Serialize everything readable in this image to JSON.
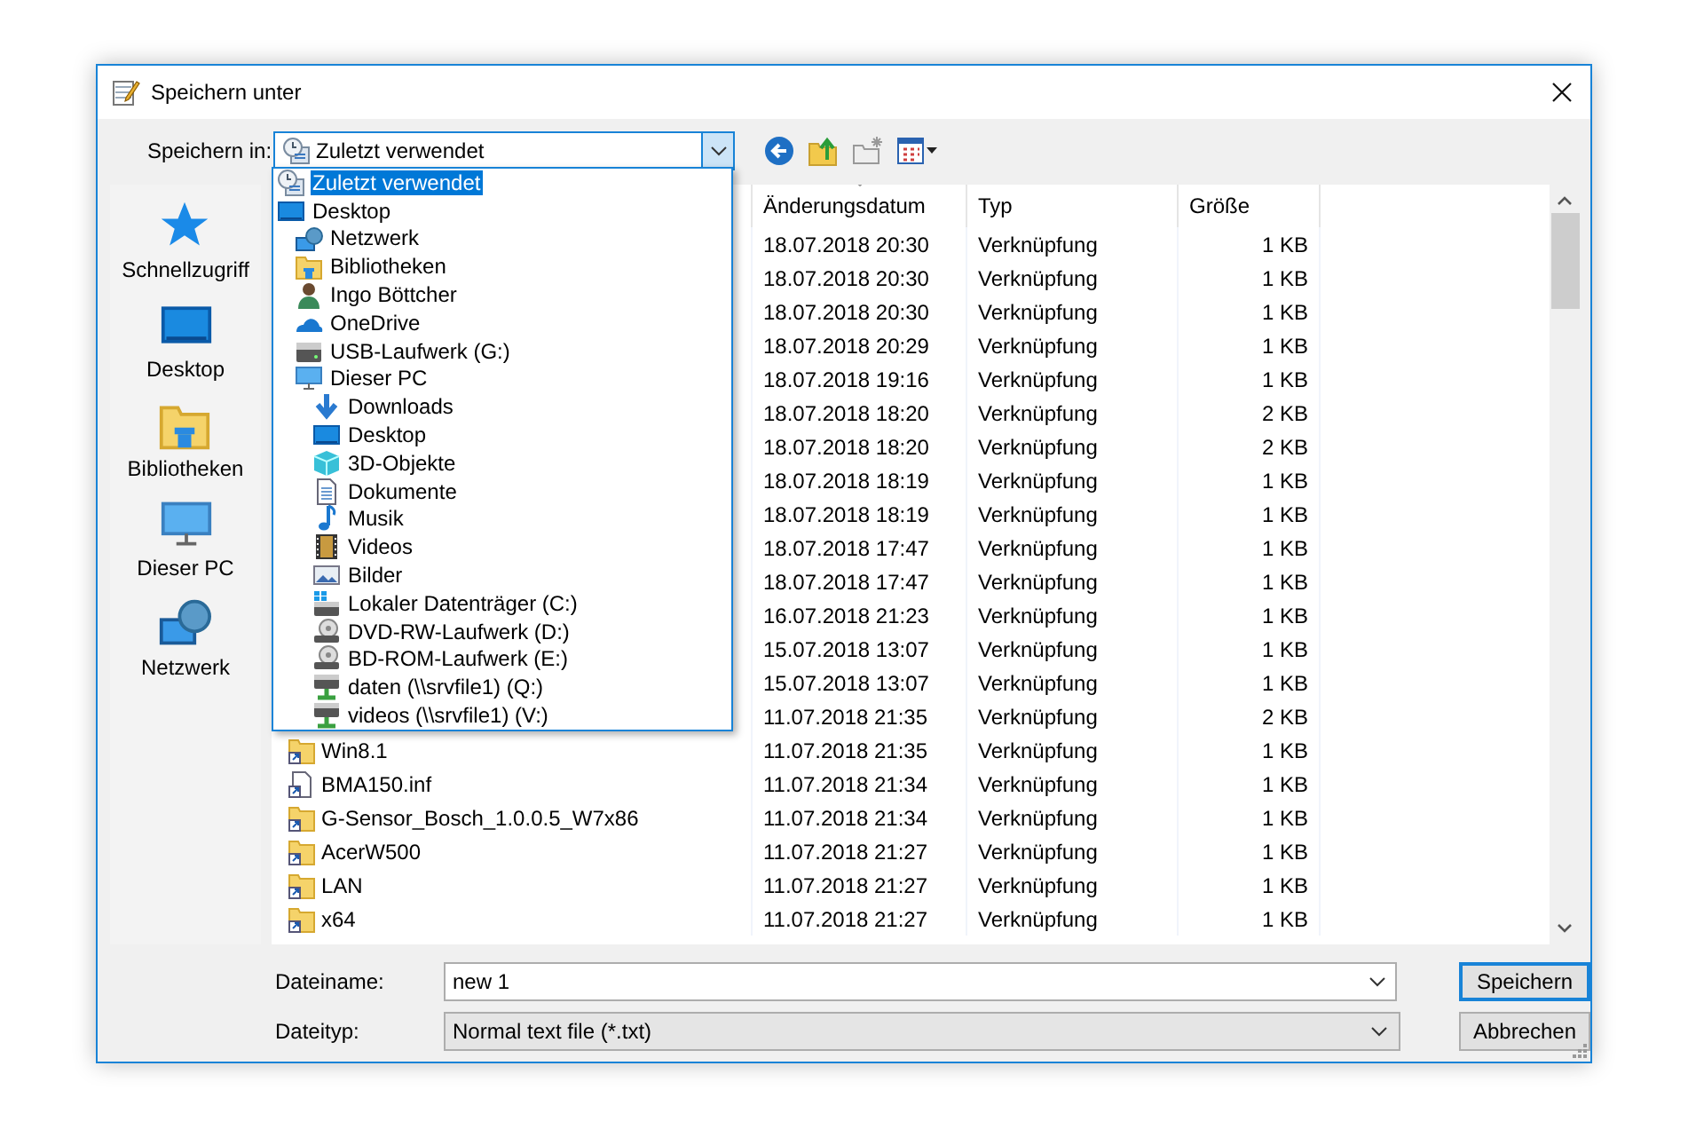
{
  "window": {
    "title": "Speichern unter"
  },
  "location": {
    "label": "Speichern in:",
    "value": "Zuletzt verwendet",
    "kind": "recent"
  },
  "location_menu": [
    {
      "label": "Zuletzt verwendet",
      "kind": "recent",
      "selected": true
    },
    {
      "label": "Desktop",
      "kind": "desktop",
      "selected": false,
      "children": [
        {
          "label": "Netzwerk",
          "kind": "network",
          "selected": false
        },
        {
          "label": "Bibliotheken",
          "kind": "library",
          "selected": false
        },
        {
          "label": "Ingo Böttcher",
          "kind": "user",
          "selected": false
        },
        {
          "label": "OneDrive",
          "kind": "cloud",
          "selected": false
        },
        {
          "label": "USB-Laufwerk (G:)",
          "kind": "drive",
          "selected": false
        },
        {
          "label": "Dieser PC",
          "kind": "pc",
          "selected": false,
          "children": [
            {
              "label": "Downloads",
              "kind": "downloads",
              "selected": false
            },
            {
              "label": "Desktop",
              "kind": "desktop",
              "selected": false
            },
            {
              "label": "3D-Objekte",
              "kind": "cube",
              "selected": false
            },
            {
              "label": "Dokumente",
              "kind": "document",
              "selected": false
            },
            {
              "label": "Musik",
              "kind": "music",
              "selected": false
            },
            {
              "label": "Videos",
              "kind": "video",
              "selected": false
            },
            {
              "label": "Bilder",
              "kind": "picture",
              "selected": false
            },
            {
              "label": "Lokaler Datenträger (C:)",
              "kind": "system-drive",
              "selected": false
            },
            {
              "label": "DVD-RW-Laufwerk (D:)",
              "kind": "optical",
              "selected": false
            },
            {
              "label": "BD-ROM-Laufwerk (E:)",
              "kind": "optical",
              "selected": false
            },
            {
              "label": "daten (\\\\srvfile1) (Q:)",
              "kind": "net-drive",
              "selected": false
            },
            {
              "label": "videos (\\\\srvfile1) (V:)",
              "kind": "net-drive",
              "selected": false
            }
          ]
        }
      ]
    }
  ],
  "sidebar": {
    "items": [
      {
        "label": "Schnellzugriff",
        "kind": "star"
      },
      {
        "label": "Desktop",
        "kind": "desktop"
      },
      {
        "label": "Bibliotheken",
        "kind": "library"
      },
      {
        "label": "Dieser PC",
        "kind": "pc"
      },
      {
        "label": "Netzwerk",
        "kind": "network"
      }
    ]
  },
  "file_list": {
    "columns": [
      {
        "label": "Änderungsdatum",
        "sorted": true
      },
      {
        "label": "Typ",
        "sorted": false
      },
      {
        "label": "Größe",
        "sorted": false
      }
    ],
    "rows": [
      {
        "date": "18.07.2018 20:30",
        "type": "Verknüpfung",
        "size": "1 KB"
      },
      {
        "date": "18.07.2018 20:30",
        "type": "Verknüpfung",
        "size": "1 KB"
      },
      {
        "date": "18.07.2018 20:30",
        "type": "Verknüpfung",
        "size": "1 KB"
      },
      {
        "date": "18.07.2018 20:29",
        "type": "Verknüpfung",
        "size": "1 KB"
      },
      {
        "date": "18.07.2018 19:16",
        "type": "Verknüpfung",
        "size": "1 KB"
      },
      {
        "date": "18.07.2018 18:20",
        "type": "Verknüpfung",
        "size": "2 KB"
      },
      {
        "date": "18.07.2018 18:20",
        "type": "Verknüpfung",
        "size": "2 KB"
      },
      {
        "date": "18.07.2018 18:19",
        "type": "Verknüpfung",
        "size": "1 KB"
      },
      {
        "date": "18.07.2018 18:19",
        "type": "Verknüpfung",
        "size": "1 KB"
      },
      {
        "date": "18.07.2018 17:47",
        "type": "Verknüpfung",
        "size": "1 KB"
      },
      {
        "date": "18.07.2018 17:47",
        "type": "Verknüpfung",
        "size": "1 KB"
      },
      {
        "date": "16.07.2018 21:23",
        "type": "Verknüpfung",
        "size": "1 KB"
      },
      {
        "date": "15.07.2018 13:07",
        "type": "Verknüpfung",
        "size": "1 KB"
      },
      {
        "date": "15.07.2018 13:07",
        "type": "Verknüpfung",
        "size": "1 KB"
      },
      {
        "date": "11.07.2018 21:35",
        "type": "Verknüpfung",
        "size": "2 KB"
      },
      {
        "name": "Win8.1",
        "kind": "folder-link",
        "date": "11.07.2018 21:35",
        "type": "Verknüpfung",
        "size": "1 KB"
      },
      {
        "name": "BMA150.inf",
        "kind": "file-link",
        "date": "11.07.2018 21:34",
        "type": "Verknüpfung",
        "size": "1 KB"
      },
      {
        "name": "G-Sensor_Bosch_1.0.0.5_W7x86",
        "kind": "folder-link",
        "date": "11.07.2018 21:34",
        "type": "Verknüpfung",
        "size": "1 KB"
      },
      {
        "name": "AcerW500",
        "kind": "folder-link",
        "date": "11.07.2018 21:27",
        "type": "Verknüpfung",
        "size": "1 KB"
      },
      {
        "name": "LAN",
        "kind": "folder-link",
        "date": "11.07.2018 21:27",
        "type": "Verknüpfung",
        "size": "1 KB"
      },
      {
        "name": "x64",
        "kind": "folder-link",
        "date": "11.07.2018 21:27",
        "type": "Verknüpfung",
        "size": "1 KB"
      }
    ]
  },
  "filename": {
    "label": "Dateiname:",
    "value": "new 1"
  },
  "filetype": {
    "label": "Dateityp:",
    "value": "Normal text file (*.txt)"
  },
  "buttons": [
    {
      "label": "Speichern",
      "default": true
    },
    {
      "label": "Abbrechen",
      "default": false
    }
  ]
}
